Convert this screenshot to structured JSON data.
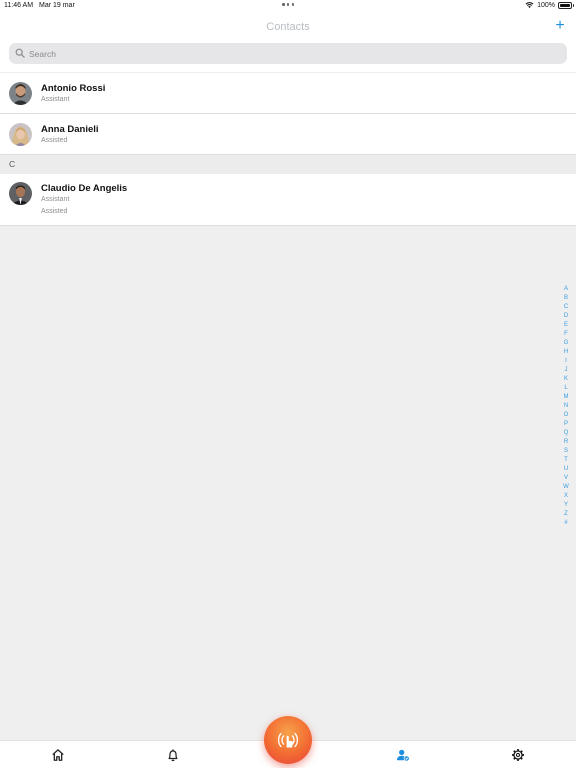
{
  "status_bar": {
    "time": "11:46 AM",
    "date": "Mar 19 mar",
    "battery": "100%",
    "battery_level": 1.0
  },
  "nav": {
    "title": "Contacts",
    "add_label": "+"
  },
  "search": {
    "placeholder": "Search",
    "value": ""
  },
  "contacts_top": [
    {
      "name": "Antonio Rossi",
      "subtitle": "Assistant",
      "avatar": "avatar-man-beard"
    },
    {
      "name": "Anna Danieli",
      "subtitle": "Assisted",
      "avatar": "avatar-woman-blonde"
    }
  ],
  "section_c": {
    "header": "C",
    "contacts": [
      {
        "name": "Claudio De Angelis",
        "subtitle": "Assistant",
        "subtitle2": "Assisted",
        "avatar": "avatar-man-suit"
      }
    ]
  },
  "alpha_index": [
    "A",
    "B",
    "C",
    "D",
    "E",
    "F",
    "G",
    "H",
    "I",
    "J",
    "K",
    "L",
    "M",
    "N",
    "O",
    "P",
    "Q",
    "R",
    "S",
    "T",
    "U",
    "V",
    "W",
    "X",
    "Y",
    "Z",
    "#"
  ],
  "tab_bar": {
    "items": [
      {
        "icon": "home-icon",
        "active": false
      },
      {
        "icon": "bell-icon",
        "active": false
      },
      {
        "icon": "panic-button-icon",
        "active": false
      },
      {
        "icon": "contacts-icon",
        "active": true
      },
      {
        "icon": "gear-icon",
        "active": false
      }
    ]
  },
  "colors": {
    "accent": "#1e8fe0",
    "index": "#3a9ee6",
    "fab_start": "#f7a24a",
    "fab_end": "#e8413a",
    "background": "#efefef"
  }
}
